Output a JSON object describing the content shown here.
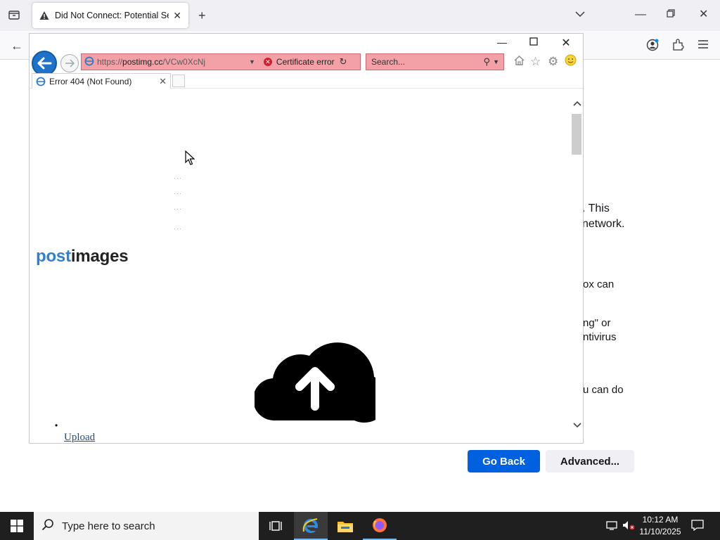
{
  "firefox": {
    "tab_title": "Did Not Connect: Potential Secu",
    "content_fragments": [
      ". This",
      "network.",
      "ox can",
      "ng\" or",
      "ntivirus",
      "u can do"
    ],
    "go_back_label": "Go Back",
    "advanced_label": "Advanced..."
  },
  "ie": {
    "url_prefix": "https://",
    "url_host": "postimg.cc",
    "url_path": "/VCw0XcNj",
    "cert_label": "Certificate error",
    "search_placeholder": "Search...",
    "tab_title": "Error 404 (Not Found)",
    "logo_part1": "post",
    "logo_part2": "images",
    "bullet": "•",
    "upload_label": "Upload"
  },
  "taskbar": {
    "search_placeholder": "Type here to search",
    "time": "10:12 AM",
    "date": "11/10/2025"
  },
  "colors": {
    "ff_button_blue": "#0061e0",
    "ie_cert_error_pink": "#f3a0a7",
    "logo_blue": "#2f80d1"
  },
  "icons": [
    "tab-list-icon",
    "warning-icon",
    "new-tab-icon",
    "ff-back-icon",
    "account-icon",
    "extensions-icon",
    "menu-icon",
    "ie-back-icon",
    "ie-forward-icon",
    "home-icon",
    "favorites-icon",
    "settings-icon",
    "smiley-icon",
    "upload-cloud-icon",
    "windows-start-icon",
    "task-view-icon",
    "edge-ie-icon",
    "file-explorer-icon",
    "firefox-icon",
    "network-icon",
    "volume-muted-icon",
    "notification-icon"
  ]
}
